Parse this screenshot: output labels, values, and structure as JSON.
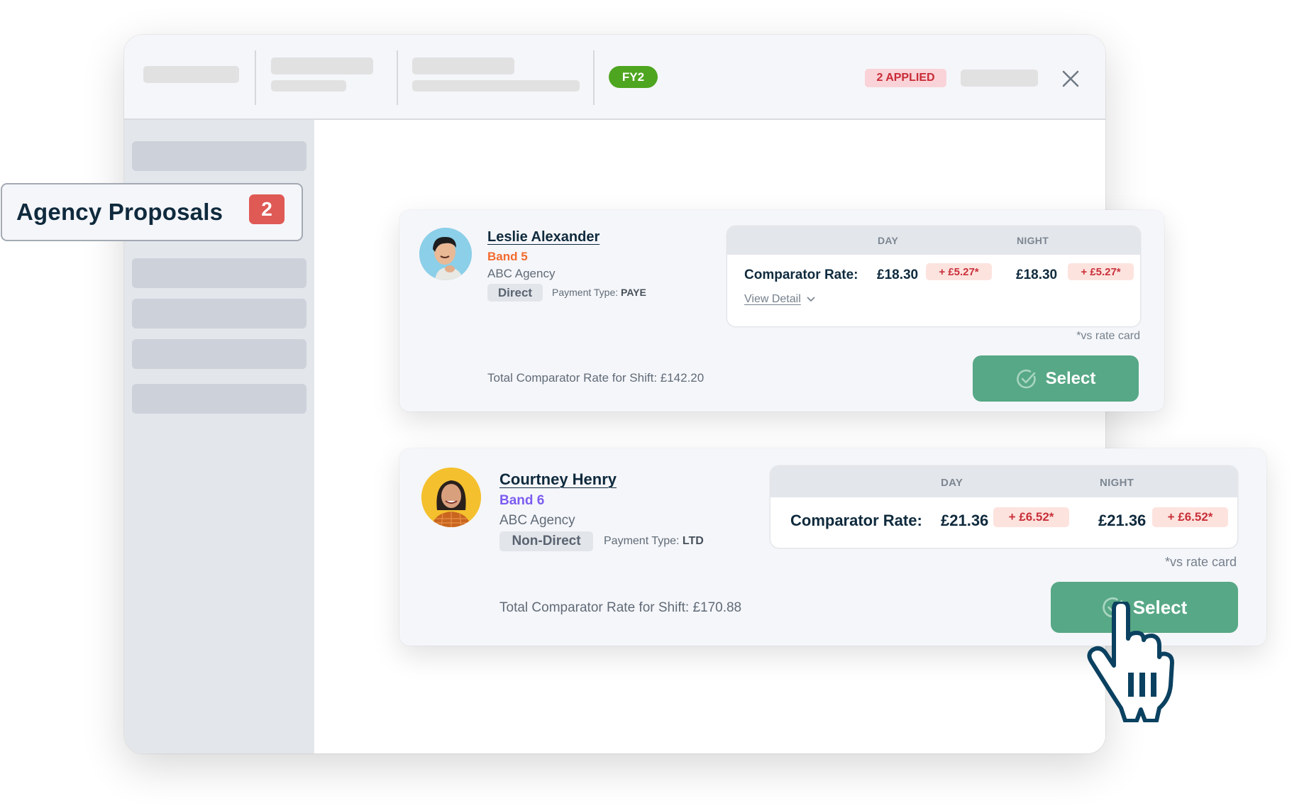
{
  "topbar": {
    "fy_badge": "FY2",
    "applied_badge": "2 APPLIED",
    "close_icon": "close-icon"
  },
  "callout": {
    "title": "Agency Proposals",
    "count": "2"
  },
  "rate_note": "*vs rate card",
  "columns": {
    "day": "DAY",
    "night": "NIGHT"
  },
  "proposals": [
    {
      "name": "Leslie Alexander",
      "band": "Band 5",
      "band_color": "#f26b2e",
      "agency": "ABC Agency",
      "type": "Direct",
      "payment_label": "Payment Type:",
      "payment_value": "PAYE",
      "rate_label": "Comparator Rate:",
      "day_rate": "£18.30",
      "day_diff": "+ £5.27*",
      "night_rate": "£18.30",
      "night_diff": "+ £5.27*",
      "view_detail": "View Detail",
      "total": "Total Comparator Rate for Shift: £142.20",
      "select_label": "Select"
    },
    {
      "name": "Courtney Henry",
      "band": "Band 6",
      "band_color": "#7b5cf0",
      "agency": "ABC Agency",
      "type": "Non-Direct",
      "payment_label": "Payment Type:",
      "payment_value": "LTD",
      "rate_label": "Comparator Rate:",
      "day_rate": "£21.36",
      "day_diff": "+ £6.52*",
      "night_rate": "£21.36",
      "night_diff": "+ £6.52*",
      "total": "Total Comparator Rate for Shift: £170.88",
      "select_label": "Select"
    }
  ],
  "colors": {
    "select_green": "#57a886",
    "fy_green": "#4ea51f",
    "count_red": "#df5a55",
    "diff_red": "#c9303a"
  }
}
